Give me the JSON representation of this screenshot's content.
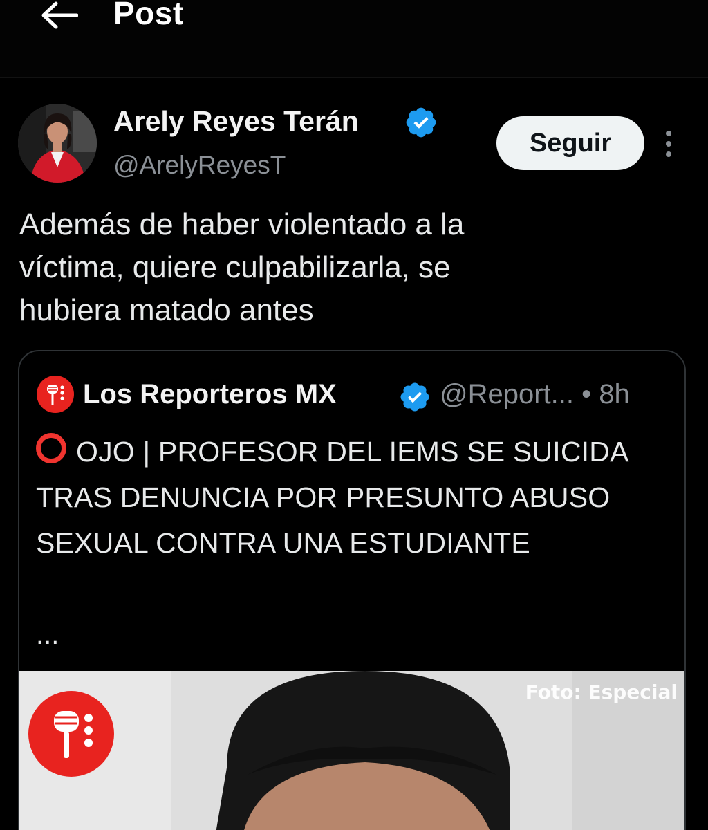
{
  "header": {
    "back_icon": "arrow-left-icon",
    "title": "Post"
  },
  "post": {
    "author": {
      "name": "Arely Reyes Terán",
      "handle": "@ArelyReyesT",
      "verified": true
    },
    "follow_label": "Seguir",
    "text": "Además de haber violentado a la\nvíctima, quiere culpabilizarla, se\nhubiera matado antes"
  },
  "quote": {
    "author_name": "Los Reporteros MX",
    "handle_time": "@Report... • 8h",
    "verified": true,
    "text": "OJO | PROFESOR DEL IEMS SE SUICIDA TRAS DENUNCIA POR PRESUNTO ABUSO SEXUAL CONTRA UNA ESTUDIANTE",
    "ellipsis": "...",
    "media": {
      "credit": "Foto: Especial"
    }
  },
  "colors": {
    "background": "#000000",
    "text": "#e7e9ea",
    "muted": "#8b9096",
    "verified": "#1d9bf0",
    "brand_red": "#e8231f"
  }
}
